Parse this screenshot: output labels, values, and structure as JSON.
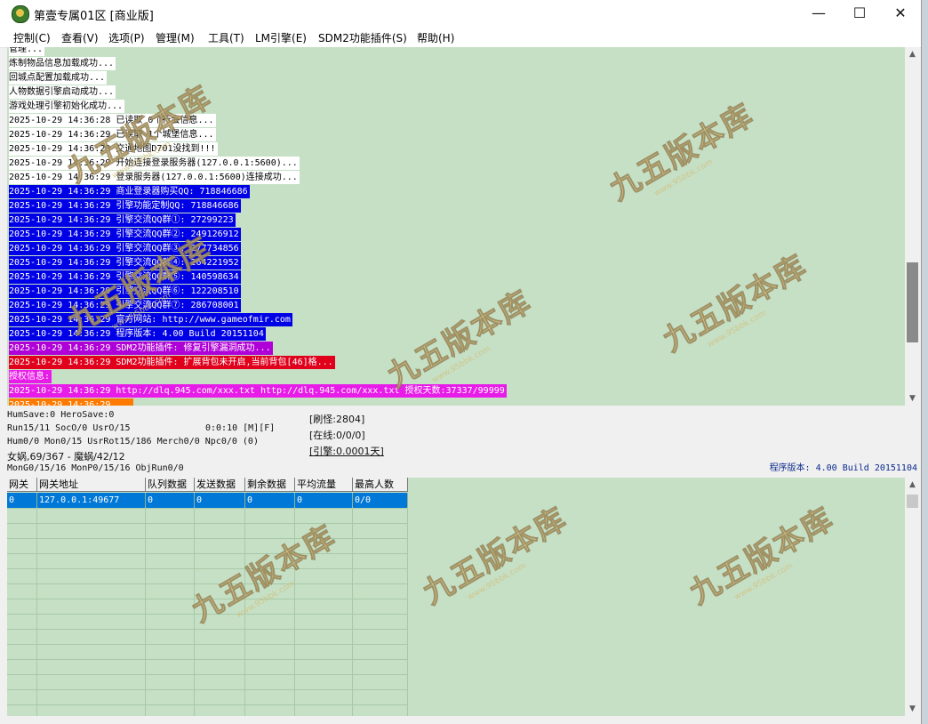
{
  "window": {
    "title": "第壹专属01区 [商业版]",
    "controls": {
      "minimize": "—",
      "maximize": "☐",
      "close": "✕"
    }
  },
  "menu": [
    "控制(C)",
    "查看(V)",
    "选项(P)",
    "管理(M)",
    "工具(T)",
    "LM引擎(E)",
    "SDM2功能插件(S)",
    "帮助(H)"
  ],
  "log": [
    {
      "time": "",
      "text": "管理...",
      "bg": "#ffffff",
      "color": "#000000"
    },
    {
      "time": "",
      "text": "炼制物品信息加载成功...",
      "bg": "#ffffff",
      "color": "#000000"
    },
    {
      "time": "",
      "text": "回城点配置加载成功...",
      "bg": "#ffffff",
      "color": "#000000"
    },
    {
      "time": "",
      "text": "人物数据引擎启动成功...",
      "bg": "#ffffff",
      "color": "#000000"
    },
    {
      "time": "",
      "text": "游戏处理引擎初始化成功...",
      "bg": "#ffffff",
      "color": "#000000"
    },
    {
      "time": "2025-10-29 14:36:28",
      "text": "已读取 0个行会信息...",
      "bg": "#ffffff",
      "color": "#000000"
    },
    {
      "time": "2025-10-29 14:36:29",
      "text": "已读取 1个城堡信息...",
      "bg": "#ffffff",
      "color": "#000000"
    },
    {
      "time": "2025-10-29 14:36:29",
      "text": "交通地图D701没找到!!!",
      "bg": "#ffffff",
      "color": "#000000"
    },
    {
      "time": "2025-10-29 14:36:29",
      "text": "开始连接登录服务器(127.0.0.1:5600)...",
      "bg": "#ffffff",
      "color": "#000000"
    },
    {
      "time": "2025-10-29 14:36:29",
      "text": "登录服务器(127.0.0.1:5600)连接成功...",
      "bg": "#ffffff",
      "color": "#000000"
    },
    {
      "time": "2025-10-29 14:36:29",
      "text": "商业登录器购买QQ: 718846686",
      "bg": "#0000e6",
      "color": "#ffffff"
    },
    {
      "time": "2025-10-29 14:36:29",
      "text": "引擎功能定制QQ: 718846686",
      "bg": "#0000e6",
      "color": "#ffffff"
    },
    {
      "time": "2025-10-29 14:36:29",
      "text": "引擎交流QQ群①: 27299223",
      "bg": "#0000e6",
      "color": "#ffffff"
    },
    {
      "time": "2025-10-29 14:36:29",
      "text": "引擎交流QQ群②: 249126912",
      "bg": "#0000e6",
      "color": "#ffffff"
    },
    {
      "time": "2025-10-29 14:36:29",
      "text": "引擎交流QQ群③: 277734856",
      "bg": "#0000e6",
      "color": "#ffffff"
    },
    {
      "time": "2025-10-29 14:36:29",
      "text": "引擎交流QQ群④: 264221952",
      "bg": "#0000e6",
      "color": "#ffffff"
    },
    {
      "time": "2025-10-29 14:36:29",
      "text": "引擎交流QQ群⑤: 140598634",
      "bg": "#0000e6",
      "color": "#ffffff"
    },
    {
      "time": "2025-10-29 14:36:29",
      "text": "引擎交流QQ群⑥: 122208510",
      "bg": "#0000e6",
      "color": "#ffffff"
    },
    {
      "time": "2025-10-29 14:36:29",
      "text": "引擎交流QQ群⑦: 286708001",
      "bg": "#0000e6",
      "color": "#ffffff"
    },
    {
      "time": "2025-10-29 14:36:29",
      "text": "官方网站: http://www.gameofmir.com",
      "bg": "#0000e6",
      "color": "#ffffff"
    },
    {
      "time": "2025-10-29 14:36:29",
      "text": "程序版本: 4.00 Build 20151104",
      "bg": "#0000e6",
      "color": "#ffffff"
    },
    {
      "time": "2025-10-29 14:36:29",
      "text": "SDM2功能插件: 修复引擎漏洞成功...",
      "bg": "#b000d8",
      "color": "#ffffff"
    },
    {
      "time": "2025-10-29 14:36:29",
      "text": "SDM2功能插件: 扩展背包未开启,当前背包[46]格...",
      "bg": "#e0001c",
      "color": "#ffffff"
    },
    {
      "time": "",
      "text": "授权信息:",
      "bg": "#e81ce8",
      "color": "#ffffff"
    },
    {
      "time": "2025-10-29 14:36:29",
      "text": "http://dlq.945.com/xxx.txt http://dlq.945.com/xxx.txt 授权天数:37337/99999",
      "bg": "#e81ce8",
      "color": "#ffffff"
    },
    {
      "time": "2025-10-29 14:36:29",
      "text": "...",
      "bg": "#ff7a00",
      "color": "#ffffff"
    }
  ],
  "status": {
    "line1": "HumSave:0 HeroSave:0",
    "line2a": "Run15/11 SocO/0 UsrO/15",
    "line2b": "0:0:10 [M][F]",
    "line3": "Hum0/0 Mon0/15 UsrRot15/186 Merch0/0 Npc0/0 (0)",
    "line4": "女娲,69/367 - 魔蜗/42/12",
    "line5": "MonG0/15/16 MonP0/15/16 ObjRun0/0",
    "refresh": "[刷怪:2804]",
    "online": "[在线:0/0/0]",
    "engine": "[引擎:0.0001天]",
    "version": "程序版本: 4.00 Build 20151104"
  },
  "gate_table": {
    "columns": [
      "网关",
      "网关地址",
      "队列数据",
      "发送数据",
      "剩余数据",
      "平均流量",
      "最高人数"
    ],
    "rows": [
      [
        "0",
        "127.0.0.1:49677",
        "0",
        "0",
        "0",
        "0",
        "0/0"
      ]
    ]
  },
  "watermark": {
    "text": "九五版本库",
    "url": "www.95bbk.com"
  }
}
